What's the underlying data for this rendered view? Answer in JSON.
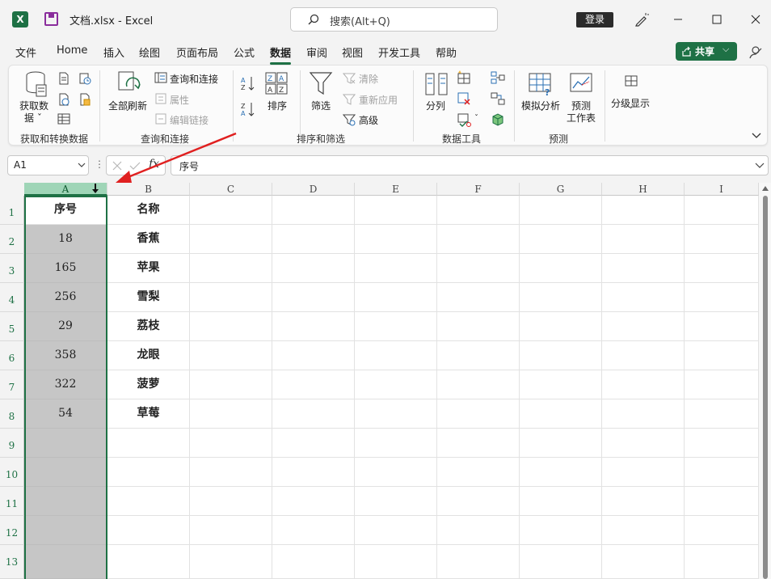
{
  "app": {
    "logo": "X",
    "doc_title": "文档.xlsx  -  Excel",
    "search_placeholder": "搜索(Alt+Q)",
    "login": "登录"
  },
  "menu": {
    "tabs": [
      "文件",
      "Home",
      "插入",
      "绘图",
      "页面布局",
      "公式",
      "数据",
      "审阅",
      "视图",
      "开发工具",
      "帮助"
    ],
    "active": "数据",
    "share": "共享"
  },
  "ribbon": {
    "get_data": "获取数",
    "get_data_2": "据 ˇ",
    "refresh_all": "全部刷新",
    "queries_connections": "查询和连接",
    "properties": "属性",
    "edit_links": "编辑链接",
    "sort": "排序",
    "filter": "筛选",
    "clear": "清除",
    "reapply": "重新应用",
    "advanced": "高级",
    "text_to_columns": "分列",
    "what_if": "模拟分析",
    "forecast_sheet_1": "预测",
    "forecast_sheet_2": "工作表",
    "outline": "分级显示",
    "groups": {
      "get_transform": "获取和转换数据",
      "queries": "查询和连接",
      "sort_filter": "排序和筛选",
      "data_tools": "数据工具",
      "forecast": "预测"
    }
  },
  "formula_bar": {
    "name_box": "A1",
    "fx": "fx",
    "content": "序号"
  },
  "sheet": {
    "columns": [
      "A",
      "B",
      "C",
      "D",
      "E",
      "F",
      "G",
      "H",
      "I"
    ],
    "rows": [
      "1",
      "2",
      "3",
      "4",
      "5",
      "6",
      "7",
      "8",
      "9",
      "10",
      "11",
      "12",
      "13"
    ],
    "col_a": [
      "序号",
      "18",
      "165",
      "256",
      "29",
      "358",
      "322",
      "54"
    ],
    "col_b": [
      "名称",
      "香蕉",
      "苹果",
      "雪梨",
      "荔枝",
      "龙眼",
      "菠萝",
      "草莓"
    ]
  },
  "colors": {
    "accent": "#1e7145",
    "selection": "#c6c6c6",
    "arrow": "#e02020"
  }
}
